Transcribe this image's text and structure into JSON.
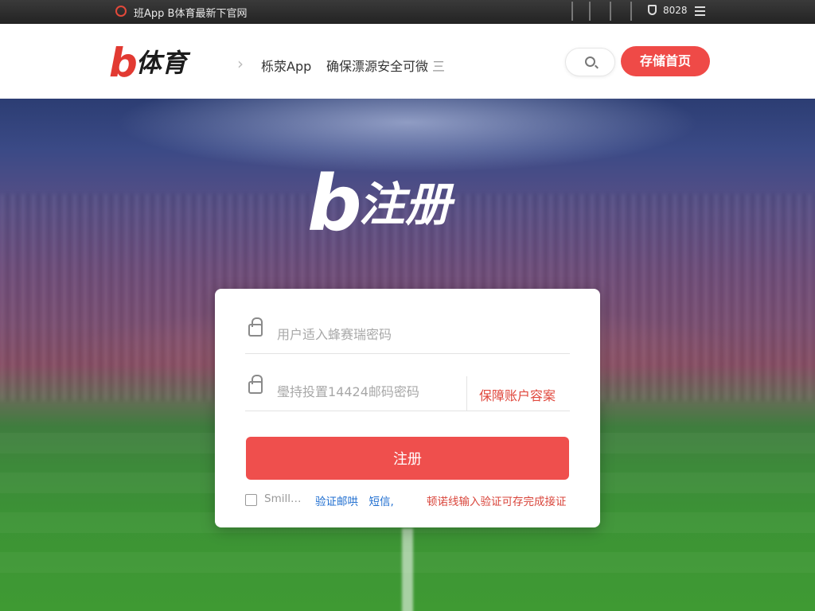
{
  "topbar": {
    "text": "班App  B体育最新下官网",
    "status": "8028"
  },
  "header": {
    "logo_b": "b",
    "logo_text": "体育",
    "nav": [
      "栎荥App",
      "确保漂源安全可微"
    ],
    "nav_mark": "三",
    "home_button": "存储首页"
  },
  "hero": {
    "title_b": "b",
    "title_text": "注册"
  },
  "form": {
    "username_placeholder": "用户适入蜂赛瑞密码",
    "password_placeholder": "璺持投置14424邮码密码",
    "password_hint": "保障账户容案",
    "submit_label": "注册",
    "agree_muted": "Smill…",
    "agree_blue": "验证邮哄　短信,",
    "agree_red": "顿诺线输入验证可存完成接证"
  },
  "colors": {
    "brand_red": "#e23a32",
    "button_red": "#ef4f4d",
    "link_blue": "#1f6ed0"
  }
}
